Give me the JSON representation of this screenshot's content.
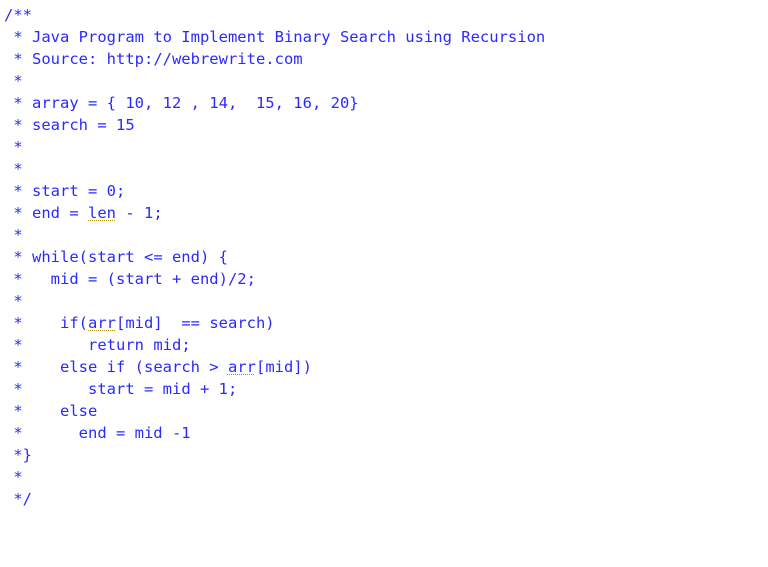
{
  "code": {
    "color": "#2a2aff",
    "lines": [
      {
        "prefix": "/**"
      },
      {
        "prefix": " * ",
        "text": "Java Program to Implement Binary Search using Recursion"
      },
      {
        "prefix": " * ",
        "text": "Source: http://webrewrite.com"
      },
      {
        "prefix": " *"
      },
      {
        "prefix": " * ",
        "text": "array = { 10, 12 , 14,  15, 16, 20}"
      },
      {
        "prefix": " * ",
        "text": "search = 15"
      },
      {
        "prefix": " *"
      },
      {
        "prefix": " *"
      },
      {
        "prefix": " * ",
        "text": "start = 0;"
      },
      {
        "prefix": " * ",
        "segments": [
          {
            "t": "end = "
          },
          {
            "t": "len",
            "warn": true
          },
          {
            "t": " - 1;"
          }
        ]
      },
      {
        "prefix": " *"
      },
      {
        "prefix": " * ",
        "text": "while(start <= end) {"
      },
      {
        "prefix": " *   ",
        "text": "mid = (start + end)/2;"
      },
      {
        "prefix": " *"
      },
      {
        "prefix": " *    ",
        "segments": [
          {
            "t": "if("
          },
          {
            "t": "arr",
            "warn": true
          },
          {
            "t": "[mid]  == search)"
          }
        ]
      },
      {
        "prefix": " *       ",
        "text": "return mid;"
      },
      {
        "prefix": " *    ",
        "segments": [
          {
            "t": "else if (search > "
          },
          {
            "t": "arr",
            "warn": true
          },
          {
            "t": "[mid])"
          }
        ]
      },
      {
        "prefix": " *       ",
        "text": "start = mid + 1;"
      },
      {
        "prefix": " *    ",
        "text": "else"
      },
      {
        "prefix": " *      ",
        "text": "end = mid -1"
      },
      {
        "prefix": " *}"
      },
      {
        "prefix": " *"
      },
      {
        "prefix": " */"
      }
    ]
  }
}
